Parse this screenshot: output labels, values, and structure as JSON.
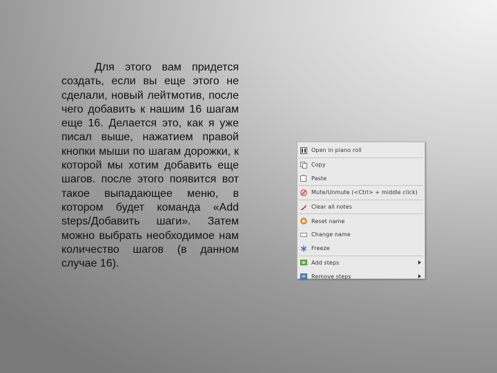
{
  "slide": {
    "body_text": "Для этого вам придется создать, если вы еще этого не сделали, новый лейтмотив, после чего добавить к нашим 16 шагам еще 16. Делается это, как я уже писал выше, нажатием правой кнопки мыши по шагам дорожки, к которой мы хотим добавить еще шагов. после этого появится вот такое выпадающее меню, в котором будет команда «Add steps/Добавить шаги». Затем можно выбрать необходимое нам количество шагов (в данном случае 16)."
  },
  "context_menu": {
    "items": [
      {
        "label": "Open in piano roll",
        "icon": "piano-roll-icon"
      },
      {
        "label": "Copy",
        "icon": "copy-icon"
      },
      {
        "label": "Paste",
        "icon": "paste-icon"
      },
      {
        "label": "Mute/Unmute (<Ctrl> + middle click)",
        "icon": "mute-icon"
      },
      {
        "label": "Clear all notes",
        "icon": "clear-notes-icon"
      },
      {
        "label": "Reset name",
        "icon": "reset-name-icon"
      },
      {
        "label": "Change name",
        "icon": "change-name-icon"
      },
      {
        "label": "Freeze",
        "icon": "freeze-icon"
      },
      {
        "label": "Add steps",
        "icon": "add-steps-icon"
      },
      {
        "label": "Remove steps",
        "icon": "remove-steps-icon"
      }
    ]
  }
}
